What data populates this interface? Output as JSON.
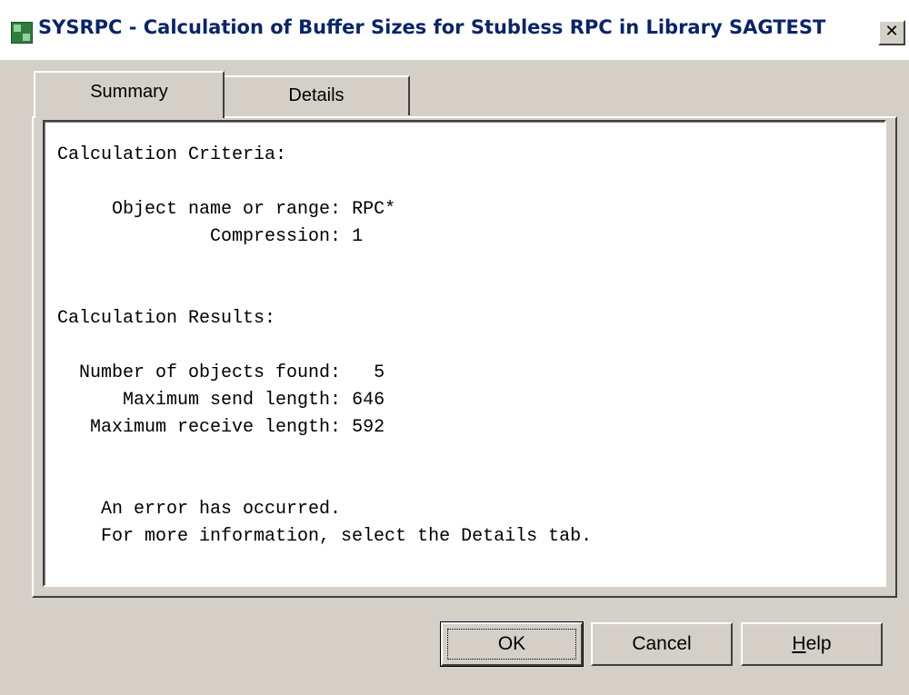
{
  "window": {
    "title": "SYSRPC - Calculation of Buffer Sizes for Stubless RPC in Library SAGTEST",
    "icon": "natural-app-icon",
    "close_label": "✕"
  },
  "tabs": [
    {
      "label": "Summary",
      "selected": true
    },
    {
      "label": "Details",
      "selected": false
    }
  ],
  "summary": {
    "criteria_heading": "Calculation Criteria:",
    "object_label": "     Object name or range:",
    "object_value": "RPC*",
    "compression_label": "              Compression:",
    "compression_value": "1",
    "results_heading": "Calculation Results:",
    "objects_found_label": "  Number of objects found:",
    "objects_found_value": "5",
    "max_send_label": "      Maximum send length:",
    "max_send_value": "646",
    "max_receive_label": "   Maximum receive length:",
    "max_receive_value": "592",
    "error_line1": "    An error has occurred.",
    "error_line2": "    For more information, select the Details tab."
  },
  "buttons": {
    "ok": "OK",
    "cancel": "Cancel",
    "help_prefix": "H",
    "help_rest": "elp"
  }
}
